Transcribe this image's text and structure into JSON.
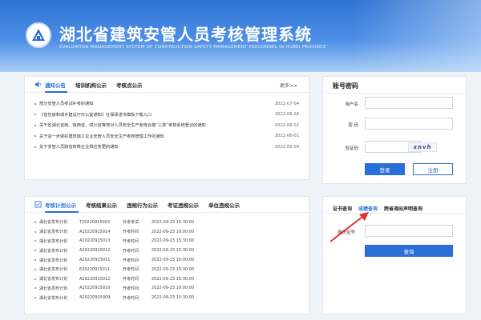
{
  "header": {
    "title": "湖北省建筑安管人员考核管理系统",
    "subtitle": "EVALUATION MANAGEMENT SYSTEM OF CONSTRUCTION SAFETY MANAGEMENT PERSONNEL IN HUBEI PROVINCE"
  },
  "notice": {
    "tabs": [
      "通知公告",
      "培训机构公示",
      "考核点公示"
    ],
    "more": "更多>>",
    "items": [
      {
        "text": "部分安管人员考试补考的通知",
        "date": "2022-07-04"
      },
      {
        "text": "《省住房和城乡建设厅办公室通知》社保承诺书模板下载入口",
        "date": "2022-06-18"
      },
      {
        "text": "关于省湖北省南、陕西省、四川省等地对人员安全生产考核合格“三类”考核系统登记的通知",
        "date": "2022-06-02"
      },
      {
        "text": "关于进一步做好建筑施工企业安管人员安全生产考核管理工作的通知",
        "date": "2022-06-01"
      },
      {
        "text": "关于安管人员跨省转移企业相应变更的通知",
        "date": "2022-05-09"
      }
    ]
  },
  "login": {
    "title": "账号密码",
    "username_label": "用户名",
    "password_label": "密 码",
    "captcha_label": "验证码",
    "captcha_text": "xnvh",
    "login_button": "登录",
    "register_button": "注册"
  },
  "exam": {
    "tabs": [
      "考核计划公示",
      "考核结果公示",
      "违规行为公示",
      "考证违规公示",
      "单位违规公示"
    ],
    "rows": [
      {
        "plan": "湖北省发布计划",
        "code": "T20220915003",
        "type": "补考考试",
        "time": "2022-09-23 15:30:00"
      },
      {
        "plan": "湖北省发布计划",
        "code": "A20220915014",
        "type": "开考时间",
        "time": "2022-09-23 10:00:00"
      },
      {
        "plan": "湖北省发布计划",
        "code": "A20220915013",
        "type": "开考时间",
        "time": "2022-09-23 15:30:00"
      },
      {
        "plan": "湖北省发布计划",
        "code": "A20220915012",
        "type": "开考时间",
        "time": "2022-09-23 15:30:00"
      },
      {
        "plan": "湖北省发布计划",
        "code": "A20220915011",
        "type": "开考时间",
        "time": "2022-09-23 10:00:00"
      },
      {
        "plan": "湖北省发布计划",
        "code": "E20220915011",
        "type": "开考时间",
        "time": "2022-09-23 15:30:00"
      },
      {
        "plan": "湖北省发布计划",
        "code": "A20220915012",
        "type": "开考时间",
        "time": "2022-09-23 15:30:00"
      },
      {
        "plan": "湖北省发布计划",
        "code": "A20220915010",
        "type": "开考时间",
        "time": "2022-09-23 10:00:00"
      },
      {
        "plan": "湖北省发布计划",
        "code": "A20220915009",
        "type": "开考时间",
        "time": "2022-09-23 15:30:00"
      }
    ]
  },
  "query": {
    "tabs": [
      "证书查询",
      "成绩查询",
      "跨省调出声明查询"
    ],
    "id_label": "身份证号",
    "query_button": "查询"
  },
  "colors": {
    "accent": "#2a6fd6",
    "arrow": "#e0302c"
  }
}
